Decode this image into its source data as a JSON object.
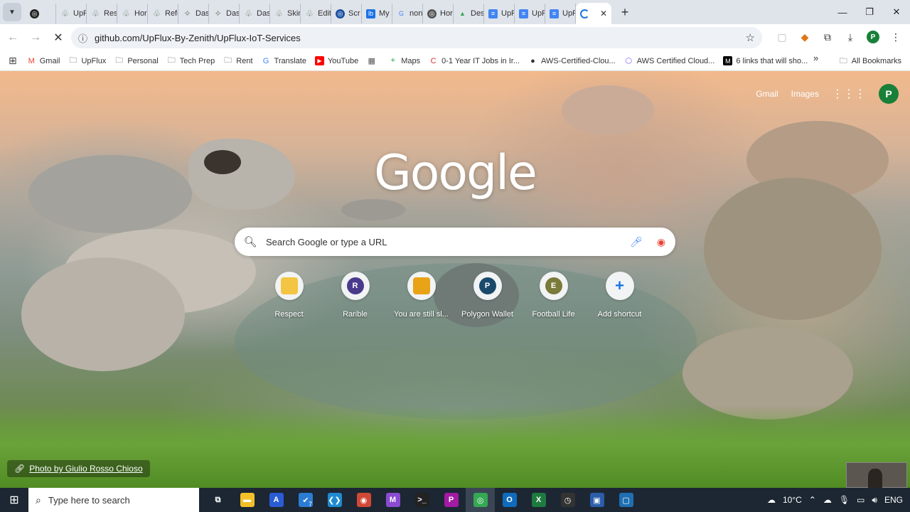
{
  "browser": {
    "tabs": [
      {
        "label": "",
        "icon": "circle-icon",
        "color": "#222222"
      },
      {
        "label": "UpF",
        "icon": "leaf-icon"
      },
      {
        "label": "Res",
        "icon": "leaf-icon"
      },
      {
        "label": "Hor",
        "icon": "leaf-icon"
      },
      {
        "label": "Refe",
        "icon": "leaf-icon"
      },
      {
        "label": "Das",
        "icon": "sparkle-icon"
      },
      {
        "label": "Das",
        "icon": "sparkle-icon"
      },
      {
        "label": "Das",
        "icon": "leaf-icon"
      },
      {
        "label": "Skin",
        "icon": "leaf-icon"
      },
      {
        "label": "Edit",
        "icon": "leaf-icon"
      },
      {
        "label": "Scr",
        "icon": "globe-icon",
        "color": "#1a4fa0"
      },
      {
        "label": "My",
        "icon": "lb-icon",
        "color": "#1a73e8"
      },
      {
        "label": "non",
        "icon": "google-icon",
        "color": "#4285f4"
      },
      {
        "label": "Hor",
        "icon": "globe-icon",
        "color": "#555555"
      },
      {
        "label": "Des",
        "icon": "drive-icon",
        "color": "#34a853"
      },
      {
        "label": "UpF",
        "icon": "doc-icon",
        "color": "#4285f4"
      },
      {
        "label": "UpF",
        "icon": "doc-icon",
        "color": "#4285f4"
      },
      {
        "label": "UpF",
        "icon": "doc-icon",
        "color": "#4285f4"
      }
    ],
    "active_tab_close": "✕",
    "new_tab": "+",
    "window": {
      "minimize": "—",
      "maximize": "❐",
      "close": "✕"
    },
    "url": "github.com/UpFlux-By-Zenith/UpFlux-IoT-Services",
    "bookmarks": [
      {
        "label": "Gmail",
        "icon": "gmail-icon",
        "color": "#ea4335"
      },
      {
        "label": "UpFlux",
        "icon": "folder-icon"
      },
      {
        "label": "Personal",
        "icon": "folder-icon"
      },
      {
        "label": "Tech Prep",
        "icon": "folder-icon"
      },
      {
        "label": "Rent",
        "icon": "folder-icon"
      },
      {
        "label": "Translate",
        "icon": "translate-icon",
        "color": "#4285f4"
      },
      {
        "label": "YouTube",
        "icon": "youtube-icon",
        "color": "#ff0000"
      },
      {
        "label": "",
        "icon": "calculator-icon",
        "color": "#555555"
      },
      {
        "label": "Maps",
        "icon": "maps-icon",
        "color": "#34a853"
      },
      {
        "label": "0-1 Year IT Jobs in Ir...",
        "icon": "c-icon",
        "color": "#d93025"
      },
      {
        "label": "AWS-Certified-Clou...",
        "icon": "github-icon",
        "color": "#333333"
      },
      {
        "label": "AWS Certified Cloud...",
        "icon": "cube-icon",
        "color": "#7b61ff"
      },
      {
        "label": "6 links that will sho...",
        "icon": "m-icon",
        "color": "#000000"
      }
    ],
    "bookmarks_more": "»",
    "all_bookmarks": "All Bookmarks",
    "profile_initial": "P"
  },
  "ntp": {
    "header_links": {
      "gmail": "Gmail",
      "images": "Images"
    },
    "profile_initial": "P",
    "logo": "Google",
    "search_placeholder": "Search Google or type a URL",
    "shortcuts": [
      {
        "label": "Respect",
        "initial": "",
        "color": "#f4c542"
      },
      {
        "label": "Rarible",
        "initial": "R",
        "color": "#4a3a8c"
      },
      {
        "label": "You are still sl...",
        "initial": "",
        "color": "#e8a317"
      },
      {
        "label": "Polygon Wallet",
        "initial": "P",
        "color": "#1a4a6b"
      },
      {
        "label": "Football Life",
        "initial": "E",
        "color": "#7a7a3a"
      },
      {
        "label": "Add shortcut",
        "initial": "+",
        "color": "#1a73e8"
      }
    ],
    "photo_credit": "Photo by Giulio Rosso Chioso"
  },
  "taskbar": {
    "search_placeholder": "Type here to search",
    "apps": [
      {
        "name": "task-view",
        "glyph": "⧉",
        "color": "#1c2733"
      },
      {
        "name": "file-explorer",
        "glyph": "▬",
        "color": "#f2c029"
      },
      {
        "name": "azure",
        "glyph": "A",
        "color": "#2a5cd6"
      },
      {
        "name": "todo",
        "glyph": "✔",
        "color": "#2b7cd3"
      },
      {
        "name": "vscode",
        "glyph": "❮❯",
        "color": "#1f8ad2"
      },
      {
        "name": "chrome-red",
        "glyph": "◉",
        "color": "#d14836"
      },
      {
        "name": "visual-studio",
        "glyph": "M",
        "color": "#8a4bd1"
      },
      {
        "name": "terminal",
        "glyph": ">_",
        "color": "#222222"
      },
      {
        "name": "jetbrains",
        "glyph": "P",
        "color": "#a31aa3"
      },
      {
        "name": "chrome",
        "glyph": "◎",
        "color": "#34a853"
      },
      {
        "name": "outlook",
        "glyph": "O",
        "color": "#0f6cbd"
      },
      {
        "name": "excel",
        "glyph": "X",
        "color": "#1f7a3f"
      },
      {
        "name": "clock",
        "glyph": "◷",
        "color": "#333333"
      },
      {
        "name": "remote-desktop",
        "glyph": "▣",
        "color": "#2b5dab"
      },
      {
        "name": "app-last",
        "glyph": "▢",
        "color": "#1f6fb2"
      }
    ],
    "badge": "7",
    "weather": "10°C",
    "language": "ENG"
  }
}
